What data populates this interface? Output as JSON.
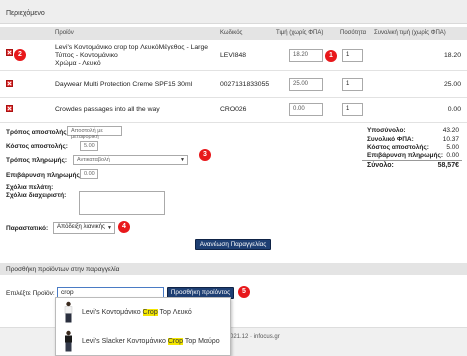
{
  "section_title": "Περιεχόμενο",
  "table": {
    "headers": [
      "Προϊόν",
      "Κωδικός",
      "Τιμή (χωρίς ΦΠΑ)",
      "Ποσότητα",
      "Συνολική τιμή (χωρίς ΦΠΑ)"
    ],
    "rows": [
      {
        "name_line1": "Levi's Κοντομάνικο crop top ΛευκόΜέγεθος - Large",
        "name_line2": "Τύπος - Κοντομάνικο",
        "name_line3": "Χρώμα - Λευκό",
        "code": "LEVI848",
        "price": "18.20",
        "qty": "1",
        "total": "18.20"
      },
      {
        "name_line1": "Daywear Multi Protection Creme SPF15 30ml",
        "code": "0027131833055",
        "price": "25.00",
        "qty": "1",
        "total": "25.00"
      },
      {
        "name_line1": "Crowdes passages into all the way",
        "code": "CRO026",
        "price": "0.00",
        "qty": "1",
        "total": "0.00"
      }
    ]
  },
  "form": {
    "shipping_method_label": "Τρόπος αποστολής:",
    "shipping_method_value": "Αποστολή με μεταφορική",
    "shipping_cost_label": "Κόστος αποστολής:",
    "shipping_cost_value": "5.00",
    "payment_method_label": "Τρόπος πληρωμής:",
    "payment_method_value": "Αντικαταβολή",
    "payment_surcharge_label": "Επιβάρυνση πληρωμής:",
    "payment_surcharge_value": "0.00",
    "customer_comments_label": "Σχόλια πελάτη:",
    "admin_comments_label": "Σχόλια διαχειριστή:",
    "receipt_label": "Παραστατικό:",
    "receipt_value": "Απόδειξη λιανικής"
  },
  "summary": {
    "subtotal_label": "Υποσύνολο:",
    "subtotal": "43.20",
    "vat_label": "Συνολικό ΦΠΑ:",
    "vat": "10.37",
    "shipping_label": "Κόστος αποστολής:",
    "shipping": "5.00",
    "surcharge_label": "Επιβάρυνση πληρωμής:",
    "surcharge": "0.00",
    "total_label": "Σύνολο:",
    "total": "58,57€"
  },
  "update_button": "Ανανέωση Παραγγελίας",
  "add_section_title": "Προσθήκη προϊόντων στην παραγγελία",
  "add_product_label": "Επιλέξτε Προϊόν:",
  "search_value": "crop",
  "add_button": "Προσθήκη προϊόντος",
  "suggestions": [
    {
      "prefix": "Levi's Κοντομάνικο ",
      "match": "Crop",
      "suffix": " Top Λευκό"
    },
    {
      "prefix": "Levi's Slacker Κοντομάνικο ",
      "match": "Crop",
      "suffix": " Top Μαύρο"
    }
  ],
  "footer_text": "021.12 · infocus.gr",
  "badges": [
    "1",
    "2",
    "3",
    "4",
    "5"
  ],
  "colors": {
    "button": "#1e3f73",
    "badge": "#e8181b",
    "highlight": "#f3e600"
  }
}
